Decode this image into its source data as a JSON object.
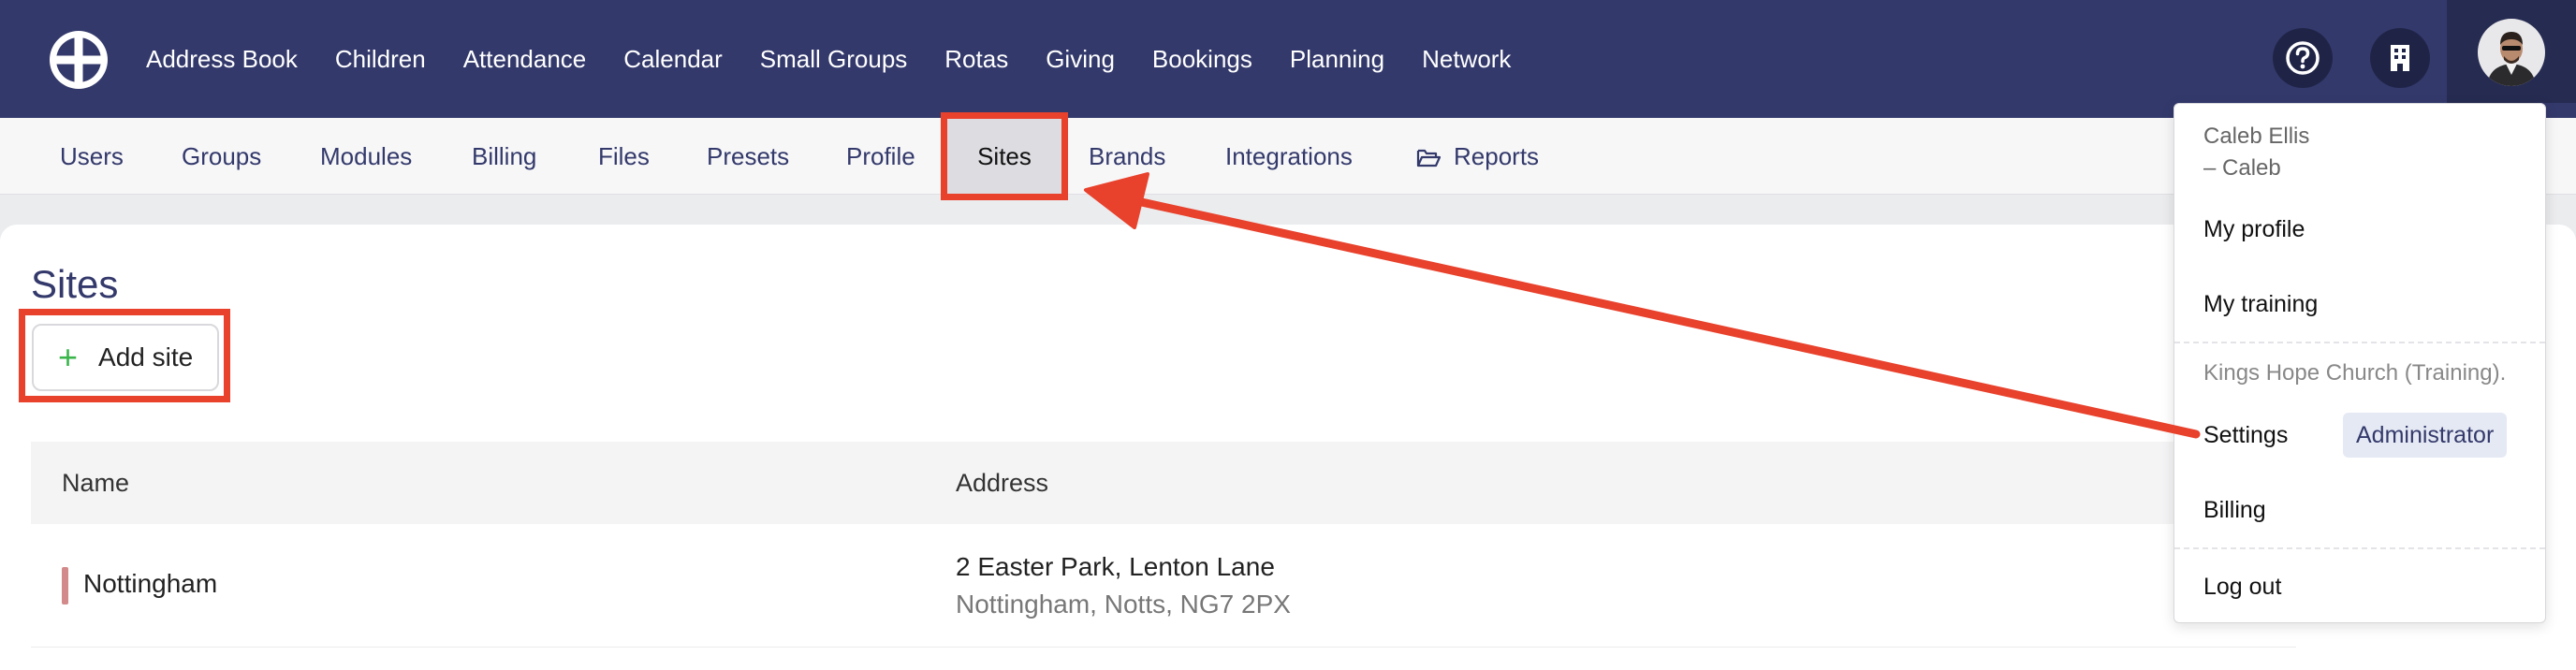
{
  "main_nav": {
    "items": [
      "Address Book",
      "Children",
      "Attendance",
      "Calendar",
      "Small Groups",
      "Rotas",
      "Giving",
      "Bookings",
      "Planning",
      "Network"
    ]
  },
  "top_icons": [
    "help-icon",
    "building-icon"
  ],
  "sub_nav": {
    "items": [
      "Users",
      "Groups",
      "Modules",
      "Billing",
      "Files",
      "Presets",
      "Profile",
      "Sites",
      "Brands",
      "Integrations",
      "Reports"
    ],
    "active": "Sites"
  },
  "page": {
    "title": "Sites",
    "add_button": "Add site"
  },
  "table": {
    "columns": [
      "Name",
      "Address"
    ],
    "rows": [
      {
        "name": "Nottingham",
        "address_line1": "2 Easter Park, Lenton Lane",
        "address_line2": "Nottingham, Notts, NG7 2PX",
        "marker_color": "#d28a8a"
      }
    ]
  },
  "dropdown": {
    "user_name": "Caleb Ellis",
    "user_short": "– Caleb",
    "my_profile": "My profile",
    "my_training": "My training",
    "organisation": "Kings Hope Church (Training).",
    "settings": "Settings",
    "role_badge": "Administrator",
    "billing": "Billing",
    "log_out": "Log out"
  },
  "colors": {
    "nav_bg": "#33396b",
    "accent": "#33396b",
    "annotation": "#e8412c",
    "plus": "#39b54a"
  }
}
